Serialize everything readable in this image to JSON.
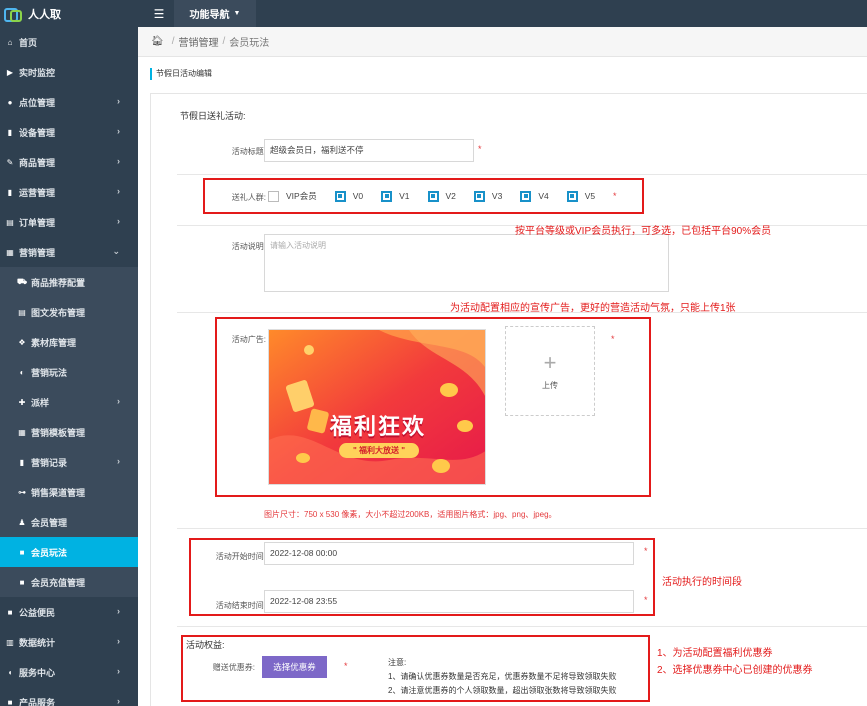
{
  "app": {
    "name": "人人取"
  },
  "topbar": {
    "menu_icon": "list-icon",
    "func_nav": "功能导航"
  },
  "sidebar": {
    "items": [
      {
        "label": "首页",
        "icon": "home-icon",
        "chev": false
      },
      {
        "label": "实时监控",
        "icon": "video-icon",
        "chev": false
      },
      {
        "label": "点位管理",
        "icon": "location-icon",
        "chev": true
      },
      {
        "label": "设备管理",
        "icon": "chart-icon",
        "chev": true
      },
      {
        "label": "商品管理",
        "icon": "edit-icon",
        "chev": true
      },
      {
        "label": "运营管理",
        "icon": "book-icon",
        "chev": true
      },
      {
        "label": "订单管理",
        "icon": "list-icon",
        "chev": true
      },
      {
        "label": "营销管理",
        "icon": "trash-icon",
        "chev": true
      }
    ],
    "sub_items": [
      {
        "label": "商品推荐配置",
        "icon": "cart-icon",
        "chev": false
      },
      {
        "label": "图文发布管理",
        "icon": "file-icon",
        "chev": false
      },
      {
        "label": "素材库管理",
        "icon": "cubes-icon",
        "chev": false
      },
      {
        "label": "营销玩法",
        "icon": "gamepad-icon",
        "chev": false
      },
      {
        "label": "派样",
        "icon": "gift-icon",
        "chev": true
      },
      {
        "label": "营销模板管理",
        "icon": "grid-icon",
        "chev": false
      },
      {
        "label": "营销记录",
        "icon": "book-icon",
        "chev": true
      },
      {
        "label": "销售渠道管理",
        "icon": "sitemap-icon",
        "chev": false
      },
      {
        "label": "会员管理",
        "icon": "users-icon",
        "chev": false
      },
      {
        "label": "会员玩法",
        "icon": "square-icon",
        "chev": false,
        "active": true
      },
      {
        "label": "会员充值管理",
        "icon": "square-icon",
        "chev": false
      }
    ],
    "bottom_items": [
      {
        "label": "公益便民",
        "icon": "square-icon",
        "chev": true
      },
      {
        "label": "数据统计",
        "icon": "bar-chart-icon",
        "chev": true
      },
      {
        "label": "服务中心",
        "icon": "headset-icon",
        "chev": true
      },
      {
        "label": "产品服务",
        "icon": "square-icon",
        "chev": true
      }
    ]
  },
  "breadcrumb": {
    "sep": "/",
    "items": [
      "营销管理",
      "会员玩法"
    ]
  },
  "panel": {
    "title": "节假日活动编辑"
  },
  "form": {
    "section_title": "节假日送礼活动:",
    "activity_title_label": "活动标题:",
    "activity_title_value": "超级会员日，福利送不停",
    "group_label": "送礼人群:",
    "groups": [
      {
        "label": "VIP会员",
        "checked": false
      },
      {
        "label": "V0",
        "checked": true
      },
      {
        "label": "V1",
        "checked": true
      },
      {
        "label": "V2",
        "checked": true
      },
      {
        "label": "V3",
        "checked": true
      },
      {
        "label": "V4",
        "checked": true
      },
      {
        "label": "V5",
        "checked": true
      }
    ],
    "desc_label": "活动说明:",
    "desc_placeholder": "请输入活动说明",
    "ad_label": "活动广告:",
    "banner_title": "福利狂欢",
    "banner_sub": "\" 福利大放送 \"",
    "upload_plus": "+",
    "upload_text": "上传",
    "image_tip": "图片尺寸：750 x 530 像素，大小不超过200KB，适用图片格式：jpg、png、jpeg。",
    "start_label": "活动开始时间:",
    "start_value": "2022-12-08 00:00",
    "end_label": "活动结束时间:",
    "end_value": "2022-12-08 23:55",
    "rights_title": "活动权益:",
    "coupon_label": "赠送优惠券:",
    "coupon_button": "选择优惠券",
    "notes_title": "注意:",
    "notes": [
      "1、请确认优惠券数量是否充足，优惠券数量不足将导致领取失败",
      "2、请注意优惠券的个人领取数量，超出领取张数将导致领取失败"
    ],
    "required_mark": "*"
  },
  "annotations": {
    "group_note": "按平台等级或VIP会员执行，可多选，已包括平台90%会员",
    "ad_note": "为活动配置相应的宣传广告，更好的营造活动气氛，只能上传1张",
    "time_note": "活动执行的时间段",
    "coupon_note_1": "1、为活动配置福利优惠券",
    "coupon_note_2": "2、选择优惠券中心已创建的优惠券",
    "color": "#e31a1a"
  }
}
